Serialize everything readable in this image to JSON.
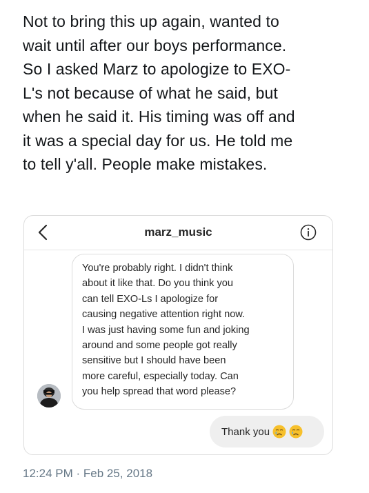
{
  "tweet": {
    "lines": [
      "Not to bring this up again, wanted to",
      "wait until after our boys performance.",
      "So I asked Marz to apologize to EXO-",
      "L's not because of what he said, but",
      "when he said it. His timing was off and",
      "it was a special day for us. He told me",
      "to tell y'all. People make mistakes."
    ]
  },
  "instagram": {
    "username": "marz_music",
    "back_icon": "chevron-left-icon",
    "info_icon": "info-icon",
    "incoming_message_lines": [
      "You're probably right. I didn't think",
      "about it like that. Do you think you",
      "can tell EXO-Ls I apologize for",
      "causing negative attention right now.",
      "I was just having some fun and joking",
      "around and some people got really",
      "sensitive but I should have been",
      "more careful, especially today. Can",
      "you help spread that word please?"
    ],
    "outgoing_message": "Thank you",
    "outgoing_emoji": [
      "crying-face-emoji",
      "crying-face-emoji"
    ]
  },
  "timestamp": "12:24 PM · Feb 25, 2018",
  "colors": {
    "text": "#14171a",
    "muted": "#657786",
    "bubble_border": "#dbdbdb",
    "bubble_fill": "#efefef",
    "emoji_yellow": "#f7c02b",
    "tear_blue": "#5aa9e6"
  }
}
